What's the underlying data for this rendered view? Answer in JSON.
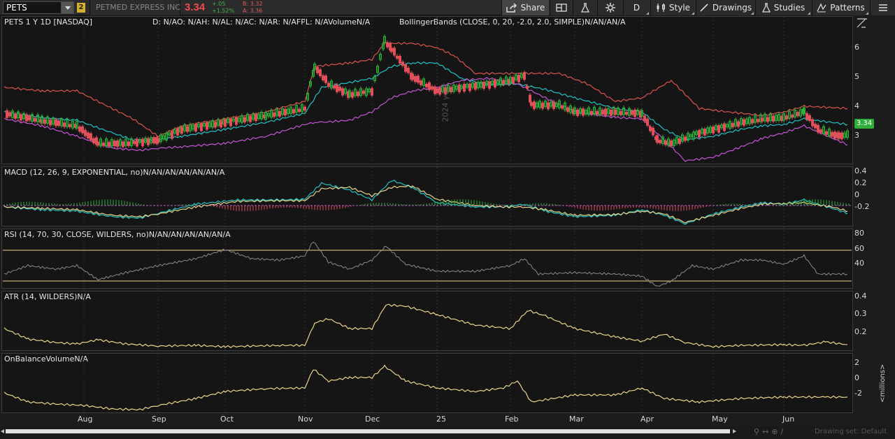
{
  "toolbar": {
    "symbol": "PETS",
    "link_badge": "2",
    "description": "PETMED EXPRESS INC",
    "last_price": "3.34",
    "change": "+.05",
    "change_pct": "+1.52%",
    "bid": "B: 3.32",
    "ask": "A: 3.36",
    "share_label": "Share",
    "aggregation_label": "D",
    "style_label": "Style",
    "drawings_label": "Drawings",
    "studies_label": "Studies",
    "patterns_label": "Patterns"
  },
  "price_pane": {
    "title": "PETS 1 Y 1D [NASDAQ]",
    "ohlc": "D: N/AO: N/AH: N/AL: N/AC: N/AR: N/AFPL: N/AVolumeN/A",
    "bollinger": "BollingerBands (CLOSE, 0, 20, -2.0, 2.0, SIMPLE)N/AN/AN/A",
    "year_marker": "2024 year",
    "axis": [
      "6",
      "5",
      "4",
      "3"
    ],
    "price_tag": "3.34"
  },
  "macd_pane": {
    "title": "MACD (12, 26, 9, EXPONENTIAL, no)N/AN/AN/AN/AN/AN/A",
    "axis": [
      "0.4",
      "0.2",
      "0",
      "-0.2"
    ]
  },
  "rsi_pane": {
    "title": "RSI (14, 70, 30, CLOSE, WILDERS, no)N/AN/AN/AN/AN/AN/A",
    "axis": [
      "80",
      "60",
      "40"
    ]
  },
  "atr_pane": {
    "title": "ATR (14, WILDERS)N/A",
    "axis": [
      "0.4",
      "0.3",
      "0.2"
    ]
  },
  "obv_pane": {
    "title": "OnBalanceVolumeN/A",
    "axis": [
      "2",
      "0",
      "-2"
    ],
    "unit": "<millions>"
  },
  "months": [
    "Aug",
    "Sep",
    "Oct",
    "Nov",
    "Dec",
    "25",
    "Feb",
    "Mar",
    "Apr",
    "May",
    "Jun"
  ],
  "status": {
    "drawing_set": "Drawing set: Default"
  },
  "colors": {
    "up": "#2fae3a",
    "down": "#e0505a",
    "bb_upper": "#d9534f",
    "bb_mid": "#22c1c3",
    "bb_lower": "#c455d6",
    "macd": "#22c1c3",
    "signal": "#e8d58a",
    "accent": "#2fae3a"
  },
  "chart_data": {
    "type": "line",
    "x_labels": [
      "Aug",
      "Sep",
      "Oct",
      "Nov",
      "Dec",
      "25",
      "Feb",
      "Mar",
      "Apr",
      "May",
      "Jun"
    ],
    "series": [
      {
        "name": "PETS",
        "values": [
          3.4,
          3.2,
          2.6,
          2.7,
          3.0,
          3.4,
          3.7,
          3.7,
          5.3,
          4.4,
          6.4,
          4.6,
          4.6,
          5.0,
          4.3,
          3.9,
          3.6,
          3.8,
          2.5,
          3.0,
          3.3,
          3.6,
          3.5,
          3.8,
          3.1,
          2.9,
          3.34
        ]
      }
    ],
    "ylim": [
      2,
      7
    ]
  }
}
